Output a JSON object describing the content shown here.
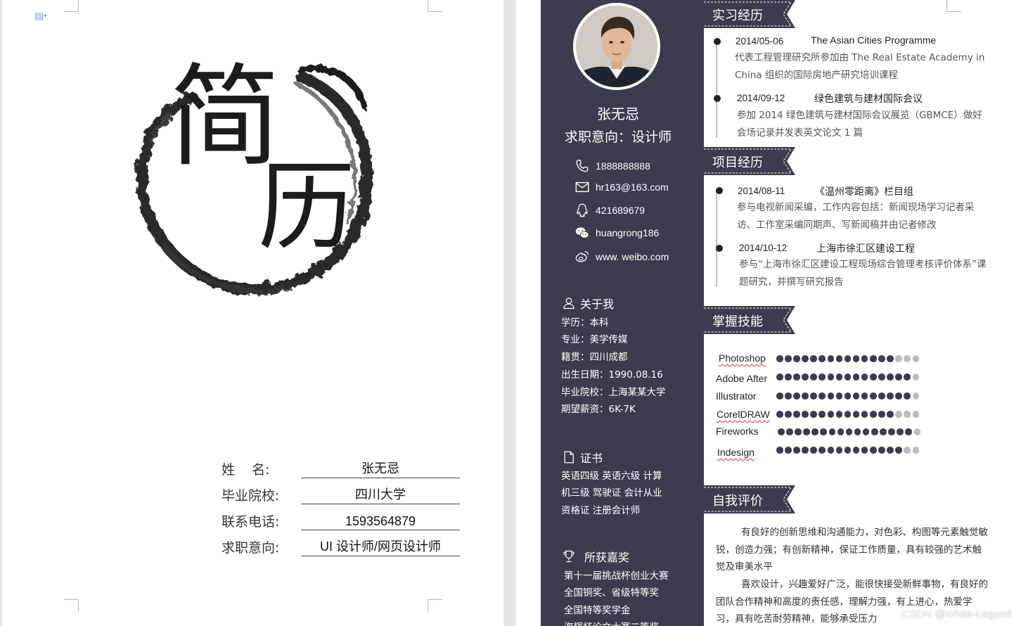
{
  "cover": {
    "title_char_1": "简",
    "title_char_2": "历",
    "fields": [
      {
        "label": "姓    名:",
        "value": "张无忌"
      },
      {
        "label": "毕业院校:",
        "value": "四川大学"
      },
      {
        "label": "联系电话:",
        "value": "1593564879"
      },
      {
        "label": "求职意向:",
        "value": "UI 设计师/网页设计师"
      }
    ]
  },
  "sidebar": {
    "name": "张无忌",
    "intention": "求职意向：设计师",
    "contacts": [
      {
        "icon": "phone-icon",
        "text": "1888888888"
      },
      {
        "icon": "mail-icon",
        "text": "hr163@163.com"
      },
      {
        "icon": "qq-icon",
        "text": "421689679"
      },
      {
        "icon": "wechat-icon",
        "text": "huangrong186"
      },
      {
        "icon": "weibo-icon",
        "text": "www. weibo.com"
      }
    ],
    "about": {
      "heading": "关于我",
      "lines": [
        "学历：本科",
        "专业：美学传媒",
        "籍贯：四川成都",
        "出生日期：1990.08.16",
        "毕业院校：上海某某大学",
        "期望薪资：6K-7K"
      ]
    },
    "certs": {
      "heading": "证书",
      "lines": [
        "英语四级   英语六级   计算",
        "机三级   驾驶证   会计从业",
        "资格证   注册会计师"
      ]
    },
    "awards": {
      "heading": "所获嘉奖",
      "lines": [
        "第十一届挑战杯创业大赛",
        "全国铜奖、省级特等奖",
        "全国特等奖学金",
        "海辉杯论文大赛二等奖"
      ]
    }
  },
  "sections": {
    "internship": "实习经历",
    "projects": "项目经历",
    "skills": "掌握技能",
    "self_eval": "自我评价"
  },
  "internships": [
    {
      "date": "2014/05-06",
      "title": "The Asian Cities Programme",
      "desc": "代表工程管理研究所参加由 The Real Estate Academy in China   组织的国际房地产研究培训课程"
    },
    {
      "date": "2014/09-12",
      "title": "绿色建筑与建材国际会议",
      "desc": "参加 2014 绿色建筑与建材国际会议展览（GBMCE）做好会场记录并发表英文论文 1 篇"
    }
  ],
  "projects": [
    {
      "date": "2014/08-11",
      "title": "《温州零距离》栏目组",
      "desc": "参与电视新闻采编，工作内容包括：新闻现场学习记者采访、工作室采编同期声、写新闻稿并由记者修改"
    },
    {
      "date": "2014/10-12",
      "title": "上海市徐汇区建设工程",
      "desc": "参与“上海市徐汇区建设工程现场综合管理考核评价体系”课题研究，并撰写研究报告"
    }
  ],
  "skills": [
    {
      "name": "Photoshop",
      "level": 14,
      "max": 17
    },
    {
      "name": "Adobe After",
      "level": 16,
      "max": 17
    },
    {
      "name": "Illustrator",
      "level": 16,
      "max": 17
    },
    {
      "name": "CorelDRAW",
      "level": 14,
      "max": 17
    },
    {
      "name": "Fireworks",
      "level": 16,
      "max": 17
    },
    {
      "name": "Indesign",
      "level": 15,
      "max": 17
    }
  ],
  "self_eval": [
    "有良好的创新思维和沟通能力，对色彩、构图等元素触觉敏锐，创造力强；有创新精神，保证工作质量，具有较强的艺术触觉及审美水平",
    "喜欢设计，兴趣爱好广泛，能很快接受新鲜事物，有良好的团队合作精神和高度的责任感，理解力强，有上进心，热爱学习，具有吃苦耐劳精神，能够承受压力"
  ],
  "watermark": "CSDN @White-Legend",
  "colors": {
    "sidebar": "#3d3b4e",
    "dot_off": "#bdbdbd"
  }
}
